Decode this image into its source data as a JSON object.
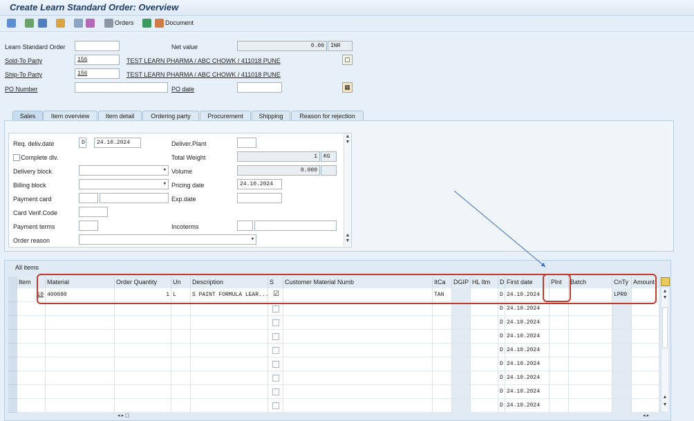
{
  "window": {
    "title": "Create Learn Standard Order: Overview"
  },
  "toolbar": {
    "orders_label": "Orders",
    "document_label": "Document"
  },
  "header": {
    "order_label": "Learn Standard Order",
    "order_value": "",
    "net_value_label": "Net value",
    "net_value": "0.00",
    "currency": "INR",
    "sold_to_label": "Sold-To Party",
    "sold_to_value": "156",
    "sold_to_desc": "TEST LEARN PHARMA / ABC CHOWK / 411018 PUNE",
    "ship_to_label": "Ship-To Party",
    "ship_to_value": "156",
    "ship_to_desc": "TEST LEARN PHARMA / ABC CHOWK / 411018 PUNE",
    "po_number_label": "PO Number",
    "po_number_value": "",
    "po_date_label": "PO date",
    "po_date_value": ""
  },
  "tabs": [
    {
      "label": "Sales"
    },
    {
      "label": "Item overview"
    },
    {
      "label": "Item detail"
    },
    {
      "label": "Ordering party"
    },
    {
      "label": "Procurement"
    },
    {
      "label": "Shipping"
    },
    {
      "label": "Reason for rejection"
    }
  ],
  "sales": {
    "req_deliv_label": "Req. deliv.date",
    "req_deliv_type": "D",
    "req_deliv_date": "24.10.2024",
    "complete_dlv_label": "Complete dlv.",
    "delivery_block_label": "Delivery block",
    "billing_block_label": "Billing block",
    "payment_card_label": "Payment card",
    "card_verif_label": "Card Verif.Code",
    "payment_terms_label": "Payment terms",
    "order_reason_label": "Order reason",
    "deliver_plant_label": "Deliver.Plant",
    "total_weight_label": "Total Weight",
    "total_weight_value": "1",
    "weight_unit": "KG",
    "volume_label": "Volume",
    "volume_value": "0.000",
    "pricing_date_label": "Pricing date",
    "pricing_date_value": "24.10.2024",
    "exp_date_label": "Exp.date",
    "incoterms_label": "Incoterms"
  },
  "items": {
    "panel_title": "All items",
    "columns": [
      "Item",
      "Material",
      "Order Quantity",
      "Un",
      "Description",
      "S",
      "Customer Material Numb",
      "ItCa",
      "DGIP",
      "HL Itm",
      "D",
      "First date",
      "Plnt",
      "Batch",
      "CnTy",
      "Amount"
    ],
    "row1": {
      "item": "10",
      "material": "400080",
      "quantity": "1",
      "unit": "L",
      "description": "S PAINT FORMULA LEAR...",
      "itca": "TAN",
      "d": "D",
      "first_date": "24.10.2024",
      "cnty": "LPR0"
    },
    "empty_row_d": "D",
    "empty_row_date": "24.10.2024"
  }
}
